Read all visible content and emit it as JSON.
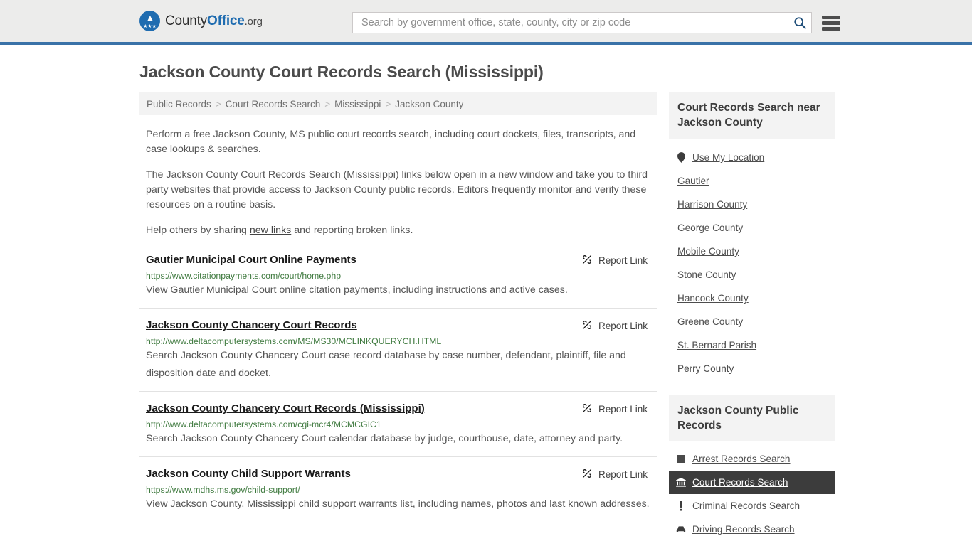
{
  "header": {
    "logo": {
      "text_1": "County",
      "text_2": "Office",
      "tld": ".org",
      "mark_icon": "eagle-shield-icon"
    },
    "search": {
      "placeholder": "Search by government office, state, county, city or zip code",
      "value": "",
      "icon": "search-icon"
    },
    "menu_icon": "hamburger-menu-icon"
  },
  "page": {
    "title": "Jackson County Court Records Search (Mississippi)"
  },
  "breadcrumb": {
    "separator": ">",
    "items": [
      {
        "label": "Public Records"
      },
      {
        "label": "Court Records Search"
      },
      {
        "label": "Mississippi"
      },
      {
        "label": "Jackson County"
      }
    ]
  },
  "intro": {
    "p1": "Perform a free Jackson County, MS public court records search, including court dockets, files, transcripts, and case lookups & searches.",
    "p2": "The Jackson County Court Records Search (Mississippi) links below open in a new window and take you to third party websites that provide access to Jackson County public records. Editors frequently monitor and verify these resources on a routine basis.",
    "p3_before": "Help others by sharing ",
    "p3_link": "new links",
    "p3_after": " and reporting broken links."
  },
  "results": {
    "report_label": "Report Link",
    "report_icon": "broken-link-icon",
    "items": [
      {
        "title": "Gautier Municipal Court Online Payments",
        "url": "https://www.citationpayments.com/court/home.php",
        "description": "View Gautier Municipal Court online citation payments, including instructions and active cases."
      },
      {
        "title": "Jackson County Chancery Court Records",
        "url": "http://www.deltacomputersystems.com/MS/MS30/MCLINKQUERYCH.HTML",
        "description": "Search Jackson County Chancery Court case record database by case number, defendant, plaintiff, file and disposition date and docket."
      },
      {
        "title": "Jackson County Chancery Court Records (Mississippi)",
        "url": "http://www.deltacomputersystems.com/cgi-mcr4/MCMCGIC1",
        "description": "Search Jackson County Chancery Court calendar database by judge, courthouse, date, attorney and party."
      },
      {
        "title": "Jackson County Child Support Warrants",
        "url": "https://www.mdhs.ms.gov/child-support/",
        "description": "View Jackson County, Mississippi child support warrants list, including names, photos and last known addresses."
      }
    ]
  },
  "sidebar": {
    "nearby": {
      "heading": "Court Records Search near Jackson County",
      "items": [
        {
          "label": "Use My Location",
          "icon": "map-pin-icon"
        },
        {
          "label": "Gautier",
          "icon": ""
        },
        {
          "label": "Harrison County",
          "icon": ""
        },
        {
          "label": "George County",
          "icon": ""
        },
        {
          "label": "Mobile County",
          "icon": ""
        },
        {
          "label": "Stone County",
          "icon": ""
        },
        {
          "label": "Hancock County",
          "icon": ""
        },
        {
          "label": "Greene County",
          "icon": ""
        },
        {
          "label": "St. Bernard Parish",
          "icon": ""
        },
        {
          "label": "Perry County",
          "icon": ""
        }
      ]
    },
    "public_records": {
      "heading": "Jackson County Public Records",
      "items": [
        {
          "label": "Arrest Records Search",
          "icon": "square-icon",
          "active": false
        },
        {
          "label": "Court Records Search",
          "icon": "courthouse-icon",
          "active": true
        },
        {
          "label": "Criminal Records Search",
          "icon": "exclamation-icon",
          "active": false
        },
        {
          "label": "Driving Records Search",
          "icon": "car-icon",
          "active": false
        }
      ]
    }
  },
  "colors": {
    "header_bg": "#ececeb",
    "header_border": "#3a72a8",
    "brand_blue": "#1f6cb0",
    "url_green": "#3f7a3f",
    "panel_gray": "#f3f3f3",
    "active_dark": "#3c3c3c"
  }
}
